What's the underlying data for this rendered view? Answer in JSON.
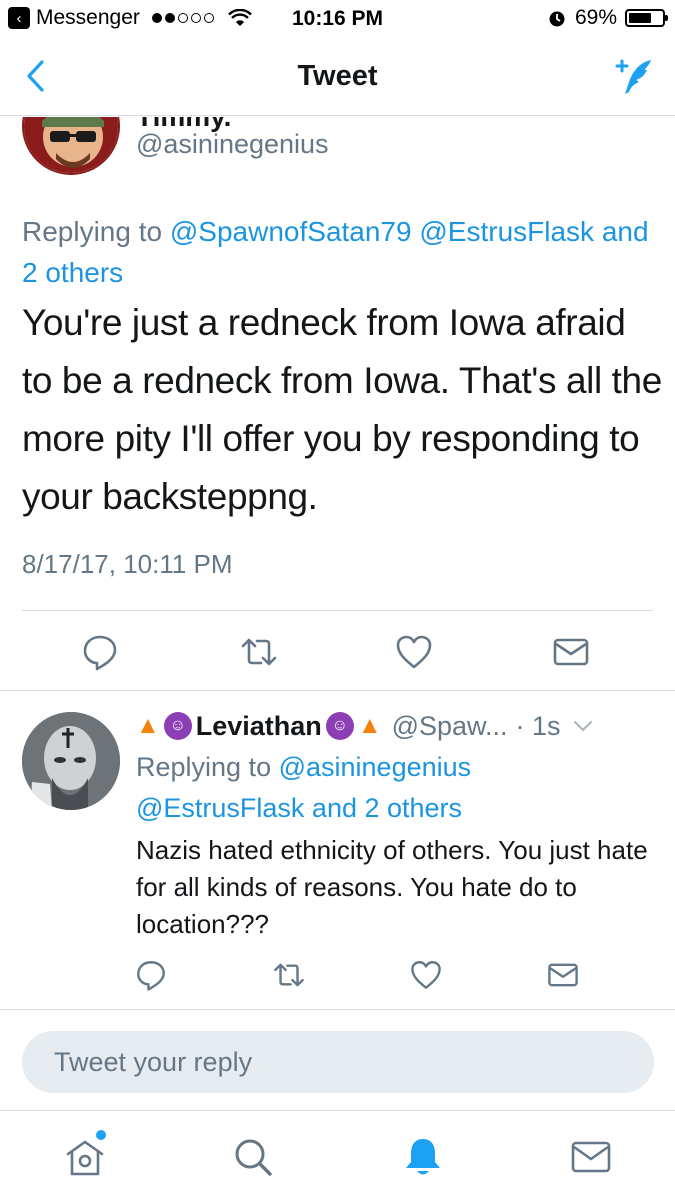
{
  "status_bar": {
    "back_app": "Messenger",
    "time": "10:16 PM",
    "battery": "69%",
    "battery_level": 0.69
  },
  "nav": {
    "title": "Tweet"
  },
  "main_tweet": {
    "name": "Timmy.",
    "handle": "@asininegenius",
    "replying_prefix": "Replying to ",
    "replying_link1": "@SpawnofSatan79",
    "replying_link2": "@EstrusFlask",
    "replying_link3": "and 2 others",
    "text": "You're just a redneck from Iowa afraid to be a redneck from Iowa. That's all the more pity I'll offer you by responding to your backsteppng.",
    "timestamp": "8/17/17, 10:11 PM"
  },
  "reply_tweet": {
    "name": "Leviathan",
    "handle": "@Spaw...",
    "time": "· 1s",
    "replying_prefix": "Replying to ",
    "replying_link1": "@asininegenius",
    "replying_link2": "@EstrusFlask and 2 others",
    "text": "Nazis hated ethnicity of others. You just hate for all kinds of reasons. You hate do to location???"
  },
  "reply_box": {
    "placeholder": "Tweet your reply"
  },
  "icons": {
    "reply": "reply-icon",
    "retweet": "retweet-icon",
    "like": "heart-icon",
    "dm": "envelope-icon",
    "home": "home-icon",
    "search": "search-icon",
    "notifications": "bell-icon",
    "messages": "envelope-icon"
  },
  "colors": {
    "accent": "#1da1f2",
    "link": "#1b95e0",
    "muted": "#657786",
    "text": "#14171a"
  }
}
